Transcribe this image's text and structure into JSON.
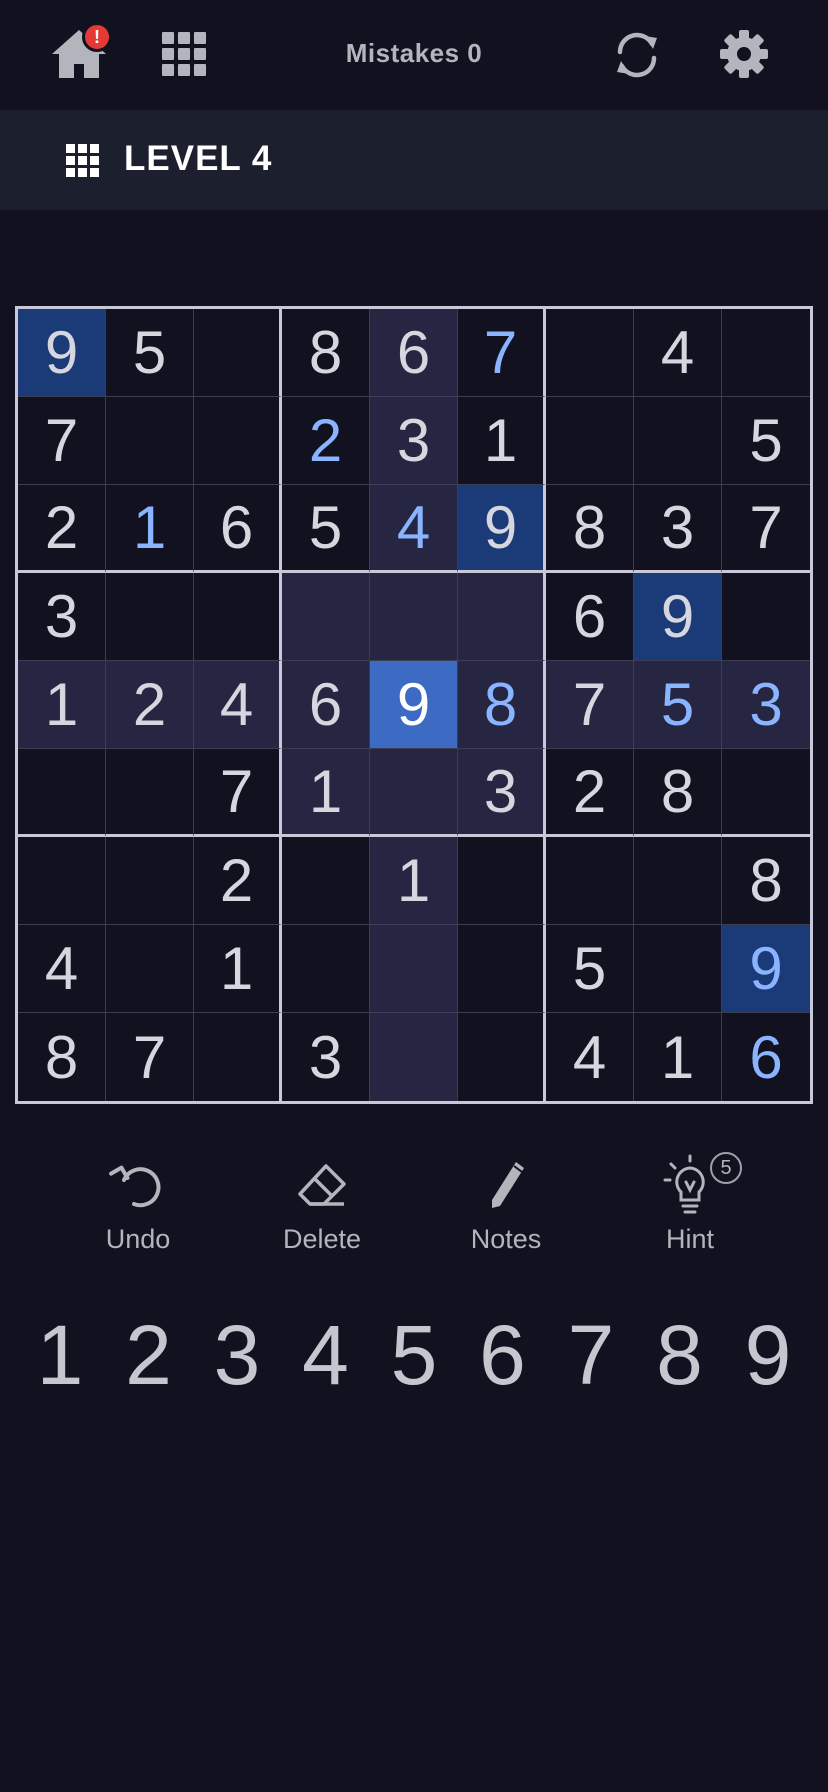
{
  "header": {
    "home_alert": "!",
    "mistakes_label": "Mistakes 0",
    "icons": [
      "home-icon",
      "grid-icon",
      "refresh-icon",
      "settings-icon"
    ]
  },
  "level": {
    "title": "LEVEL 4"
  },
  "board": {
    "rows": [
      [
        "9",
        "5",
        "",
        "8",
        "6",
        "7",
        "",
        "4",
        ""
      ],
      [
        "7",
        "",
        "",
        "2",
        "3",
        "1",
        "",
        "",
        "5"
      ],
      [
        "2",
        "1",
        "6",
        "5",
        "4",
        "9",
        "8",
        "3",
        "7"
      ],
      [
        "3",
        "",
        "",
        "",
        "",
        "",
        "6",
        "9",
        ""
      ],
      [
        "1",
        "2",
        "4",
        "6",
        "9",
        "8",
        "7",
        "5",
        "3"
      ],
      [
        "",
        "",
        "7",
        "1",
        "",
        "3",
        "2",
        "8",
        ""
      ],
      [
        "",
        "",
        "2",
        "",
        "1",
        "",
        "",
        "",
        "8"
      ],
      [
        "4",
        "",
        "1",
        "",
        "",
        "",
        "5",
        "",
        "9"
      ],
      [
        "8",
        "7",
        "",
        "3",
        "",
        "",
        "4",
        "1",
        "6"
      ]
    ],
    "user_entered": [
      [
        0,
        5
      ],
      [
        1,
        3
      ],
      [
        2,
        1
      ],
      [
        2,
        4
      ],
      [
        4,
        5
      ],
      [
        4,
        7
      ],
      [
        4,
        8
      ],
      [
        7,
        8
      ],
      [
        8,
        8
      ]
    ],
    "selected": [
      4,
      4
    ],
    "selected_value": "9",
    "colors": {
      "given": "#d6d6de",
      "user": "#8ab4ff",
      "highlight": "#262642",
      "same_value": "#1a3a78",
      "selected": "#3d6bc4"
    }
  },
  "actions": [
    {
      "label": "Undo",
      "icon": "undo-icon"
    },
    {
      "label": "Delete",
      "icon": "eraser-icon"
    },
    {
      "label": "Notes",
      "icon": "pencil-icon"
    },
    {
      "label": "Hint",
      "icon": "lightbulb-icon",
      "badge": "5"
    }
  ],
  "numpad": [
    "1",
    "2",
    "3",
    "4",
    "5",
    "6",
    "7",
    "8",
    "9"
  ]
}
